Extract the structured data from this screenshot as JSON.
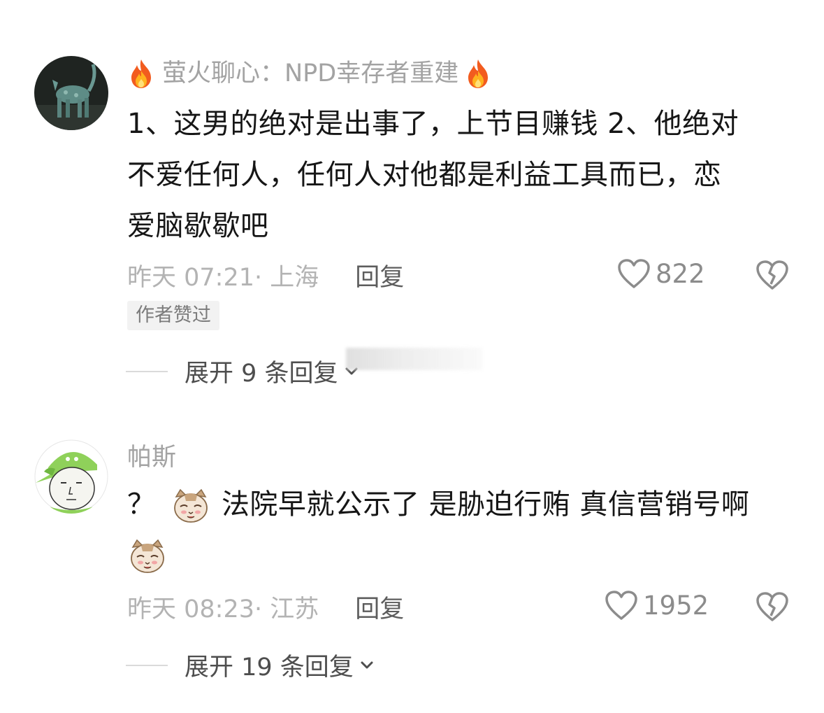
{
  "comments": [
    {
      "username": "萤火聊心：NPD幸存者重建",
      "text_lines": [
        "1、这男的绝对是出事了，上节目赚钱 2、他绝对",
        "不爱任何人，任何人对他都是利益工具而已，恋",
        "爱脑歇歇吧"
      ],
      "time_location": "昨天 07:21· 上海",
      "reply_label": "回复",
      "like_count": "822",
      "badge": "作者赞过",
      "expand_label": "展开 9 条回复"
    },
    {
      "username": "帕斯",
      "text_prefix": "？",
      "text_main": "法院早就公示了 是胁迫行贿 真信营销号啊",
      "time_location": "昨天 08:23· 江苏",
      "reply_label": "回复",
      "like_count": "1952",
      "expand_label": "展开 19 条回复"
    }
  ],
  "icons": {
    "like": "heart-outline-icon",
    "dislike": "broken-heart-icon",
    "fire": "fire-emoji-icon",
    "cat": "cat-face-emoji-icon",
    "expand": "chevron-down-icon"
  },
  "colors": {
    "username": "#a3a3a3",
    "text": "#161616",
    "meta": "#b3b3b3",
    "reply": "#5d5d5d",
    "badge_bg": "#f2f2f2"
  }
}
